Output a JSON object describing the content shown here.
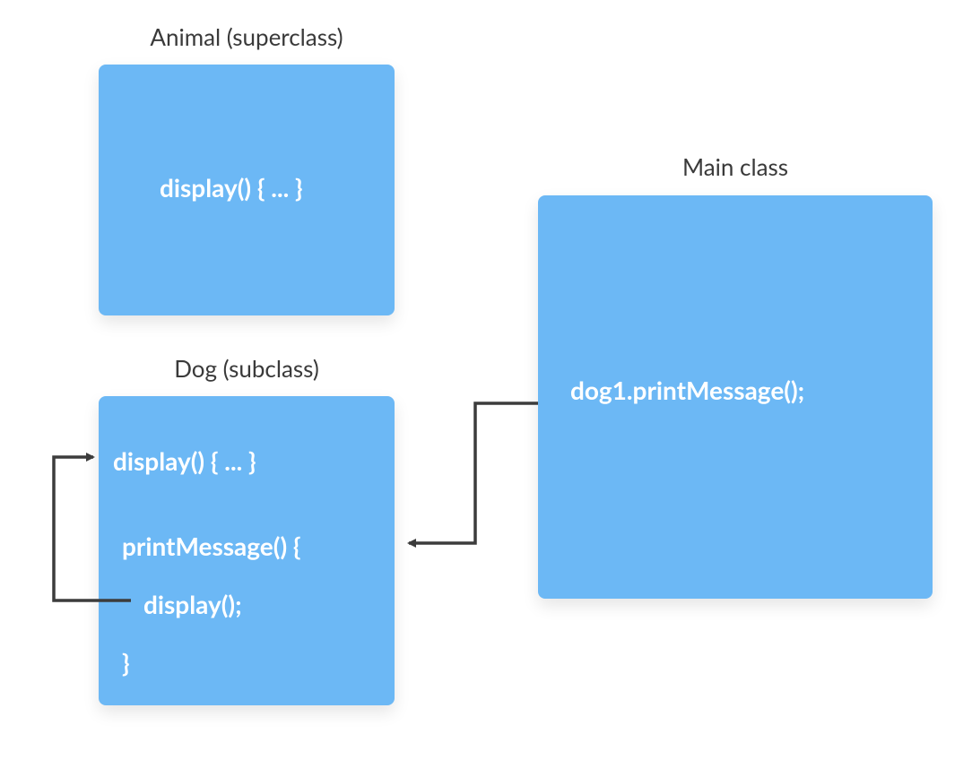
{
  "animal": {
    "label": "Animal (superclass)",
    "code": "display() { ... }"
  },
  "dog": {
    "label": "Dog (subclass)",
    "display": "display() { ... }",
    "printMessageHeader": "printMessage() {",
    "printMessageBody": "display();",
    "printMessageClose": "}"
  },
  "main": {
    "label": "Main class",
    "code": "dog1.printMessage();"
  }
}
